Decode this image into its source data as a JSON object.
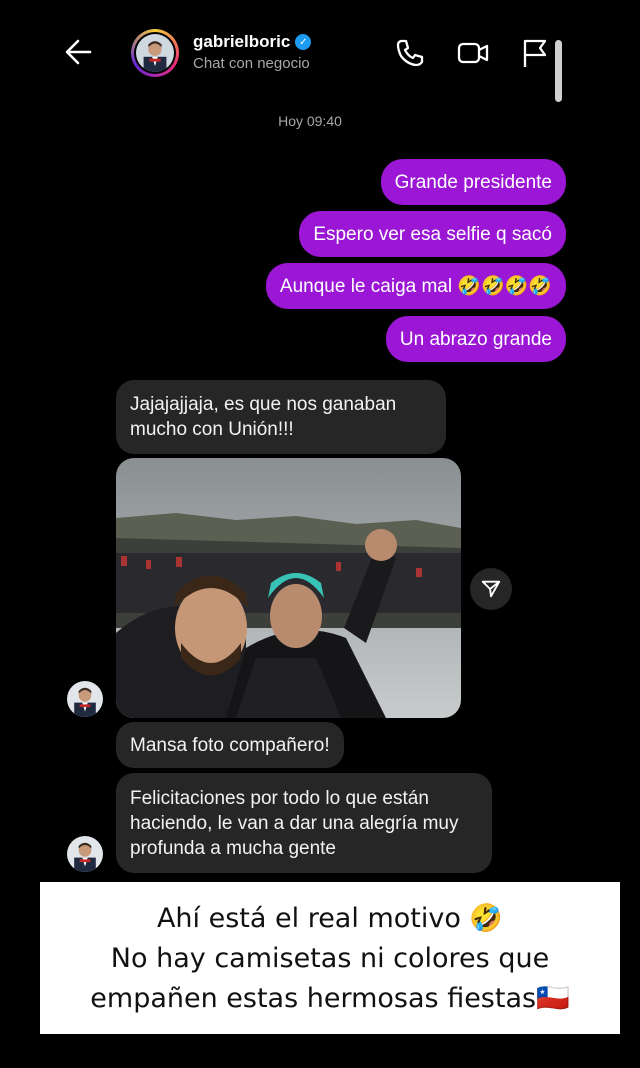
{
  "header": {
    "username": "gabrielboric",
    "subtitle": "Chat con negocio",
    "verified_icon": "verified-badge-icon"
  },
  "timestamp": "Hoy 09:40",
  "outgoing": [
    {
      "text": "Grande presidente"
    },
    {
      "text": "Espero ver esa selfie q sacó"
    },
    {
      "text": "Aunque le caiga mal 🤣🤣🤣🤣"
    },
    {
      "text": "Un abrazo grande"
    }
  ],
  "incoming": [
    {
      "text": "Jajajajjaja, es que nos ganaban mucho con Unión!!!"
    },
    {
      "text": "Mansa foto compañero!"
    },
    {
      "text": "Felicitaciones por todo lo que están haciendo, le van a dar una alegría muy profunda a mucha gente"
    }
  ],
  "caption": {
    "line1": "Ahí está el real motivo 🤣",
    "line2": "No hay camisetas ni colores que",
    "line3": "empañen estas hermosas fiestas🇨🇱"
  },
  "colors": {
    "outgoing_bubble": "#9b17d5",
    "incoming_bubble": "#262626",
    "background": "#000000"
  }
}
